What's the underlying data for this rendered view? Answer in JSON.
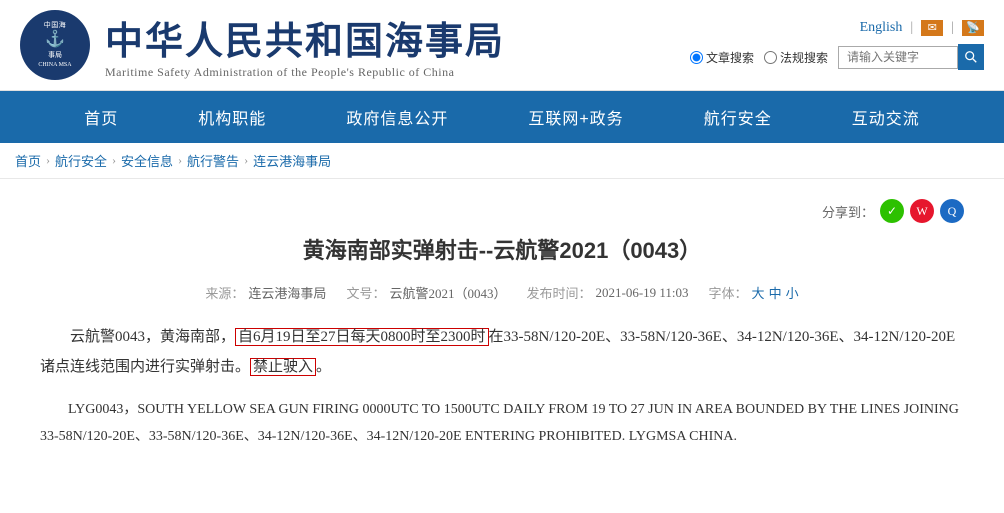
{
  "header": {
    "logo_cn_line1": "中国海",
    "logo_cn_line2": "事局",
    "logo_abbr": "CHINA MSA",
    "title_cn": "中华人民共和国海事局",
    "title_en": "Maritime Safety Administration of the People's Republic of China",
    "lang_label": "English",
    "search_placeholder": "请输入关键字",
    "radio1": "文章搜索",
    "radio2": "法规搜索"
  },
  "nav": {
    "items": [
      "首页",
      "机构职能",
      "政府信息公开",
      "互联网+政务",
      "航行安全",
      "互动交流"
    ]
  },
  "breadcrumb": {
    "items": [
      "首页",
      "航行安全",
      "安全信息",
      "航行警告",
      "连云港海事局"
    ]
  },
  "share": {
    "label": "分享到："
  },
  "article": {
    "title": "黄海南部实弹射击--云航警2021（0043）",
    "meta": {
      "source_label": "来源：",
      "source_value": "连云港海事局",
      "doc_label": "文号：",
      "doc_value": "云航警2021（0043）",
      "date_label": "发布时间：",
      "date_value": "2021-06-19 11:03",
      "font_label": "字体：",
      "font_large": "大",
      "font_medium": "中",
      "font_small": "小"
    },
    "para1_pre": "云航警0043，黄海南部，",
    "para1_highlight1": "自6月19日至27日每天0800时至2300时",
    "para1_mid": "在33-58N/120-20E、33-58N/120-36E、34-12N/120-36E、34-12N/120-20E诸点连线范围内进行实弹射击。",
    "para1_highlight2": "禁止驶入",
    "para1_end": "。",
    "para2": "LYG0043，SOUTH YELLOW SEA GUN FIRING 0000UTC TO 1500UTC DAILY FROM 19 TO 27 JUN IN AREA BOUNDED BY THE LINES JOINING 33-58N/120-20E、33-58N/120-36E、34-12N/120-36E、34-12N/120-20E ENTERING PROHIBITED. LYGMSA CHINA."
  }
}
